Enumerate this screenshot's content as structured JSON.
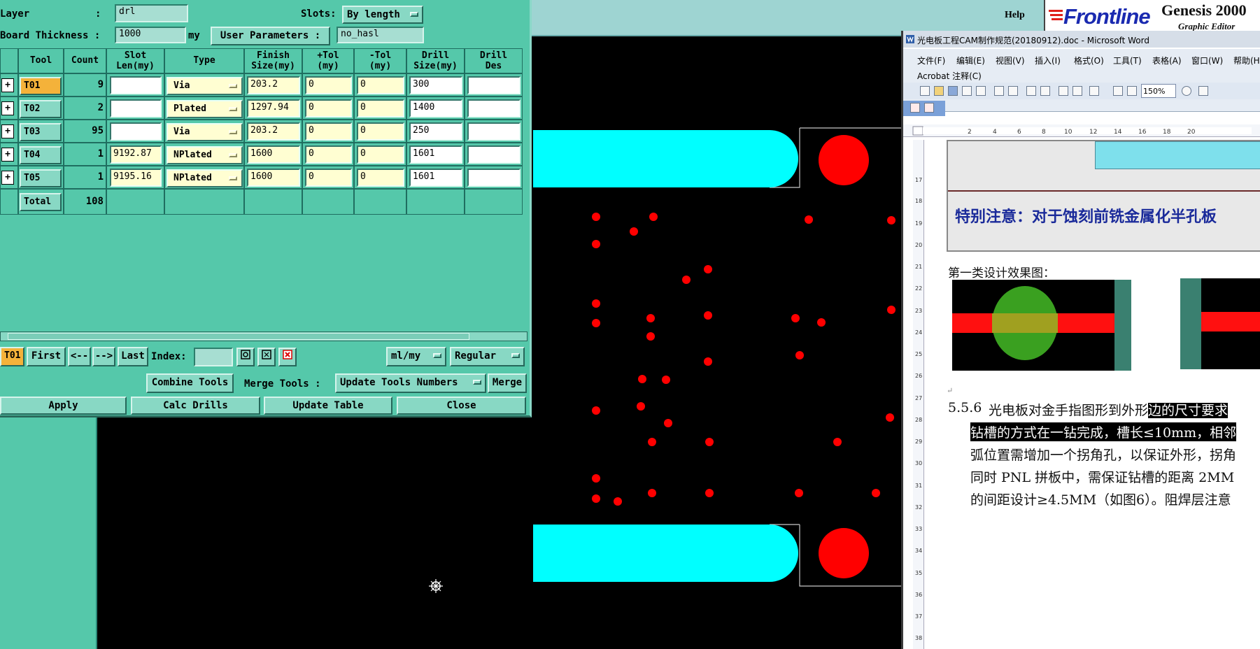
{
  "app": {
    "help_label": "Help",
    "brand": "Frontline",
    "product": "Genesis 2000",
    "product_sub": "Graphic Editor"
  },
  "drill_window": {
    "layer_label": "Layer",
    "layer_colon": ":",
    "layer_value": "drl",
    "slots_label": "Slots:",
    "slots_value": "By length",
    "board_thickness_label": "Board Thickness :",
    "board_thickness_value": "1000",
    "board_thickness_unit": "my",
    "user_params_label": "User Parameters :",
    "user_params_value": "no_hasl",
    "columns": [
      "Tool",
      "Count",
      "Slot\nLen(my)",
      "Type",
      "Finish\nSize(my)",
      "+Tol\n(my)",
      "-Tol\n(my)",
      "Drill\nSize(my)",
      "Drill\nDes"
    ],
    "rows": [
      {
        "plus": "+",
        "tool": "T01",
        "count": "9",
        "slot_len": "",
        "type": "Via",
        "finish": "203.2",
        "ptol": "0",
        "mtol": "0",
        "drill": "300",
        "des": "",
        "selected": true
      },
      {
        "plus": "+",
        "tool": "T02",
        "count": "2",
        "slot_len": "",
        "type": "Plated",
        "finish": "1297.94",
        "ptol": "0",
        "mtol": "0",
        "drill": "1400",
        "des": "",
        "selected": false
      },
      {
        "plus": "+",
        "tool": "T03",
        "count": "95",
        "slot_len": "",
        "type": "Via",
        "finish": "203.2",
        "ptol": "0",
        "mtol": "0",
        "drill": "250",
        "des": "",
        "selected": false
      },
      {
        "plus": "+",
        "tool": "T04",
        "count": "1",
        "slot_len": "9192.87",
        "type": "NPlated",
        "finish": "1600",
        "ptol": "0",
        "mtol": "0",
        "drill": "1601",
        "des": "",
        "selected": false
      },
      {
        "plus": "+",
        "tool": "T05",
        "count": "1",
        "slot_len": "9195.16",
        "type": "NPlated",
        "finish": "1600",
        "ptol": "0",
        "mtol": "0",
        "drill": "1601",
        "des": "",
        "selected": false
      }
    ],
    "total_label": "Total",
    "total_count": "108",
    "nav": {
      "current": "T01",
      "first": "First",
      "prev": "<--",
      "next": "-->",
      "last": "Last",
      "index_label": "Index:",
      "units": "ml/my",
      "mode": "Regular"
    },
    "combine_tools": "Combine Tools",
    "merge_tools_label": "Merge Tools :",
    "merge_mode": "Update Tools Numbers",
    "merge": "Merge",
    "apply": "Apply",
    "calc_drills": "Calc Drills",
    "update_table": "Update Table",
    "close": "Close"
  },
  "canvas_colors": {
    "slot": "#00ffff",
    "pad": "#ff0000",
    "bg": "#000000",
    "outline": "#c8c8c8"
  },
  "word": {
    "title": "光电板工程CAM制作规范(20180912).doc - Microsoft Word",
    "menu": [
      "文件(F)",
      "编辑(E)",
      "视图(V)",
      "插入(I)",
      "格式(O)",
      "工具(T)",
      "表格(A)",
      "窗口(W)",
      "帮助(H)"
    ],
    "acrobat_menu": "Acrobat 注释(C)",
    "zoom": "150%",
    "ruler_numbers": [
      "2",
      "4",
      "6",
      "8",
      "10",
      "12",
      "14",
      "16",
      "18",
      "20"
    ],
    "vruler_numbers": [
      "17",
      "18",
      "19",
      "20",
      "21",
      "22",
      "23",
      "24",
      "25",
      "26",
      "27",
      "28",
      "29",
      "30",
      "31",
      "32",
      "33",
      "34",
      "35",
      "36",
      "37",
      "38"
    ],
    "note": "特别注意：对于蚀刻前铣金属化半孔板",
    "section_caption": "第一类设计效果图：",
    "section_number": "5.5.6",
    "para_line1_a": "光电板对金手指图形到外形",
    "para_line1_b": "边的尺寸要求",
    "para_line2": "钻槽的方式在一钻完成，槽长≤10mm，相邻",
    "para_line3": "弧位置需增加一个拐角孔，以保证外形，拐角",
    "para_line4": "同时 PNL 拼板中，需保证钻槽的距离 2MM",
    "para_line5": "的间距设计≥4.5MM（如图6）。阻焊层注意"
  }
}
